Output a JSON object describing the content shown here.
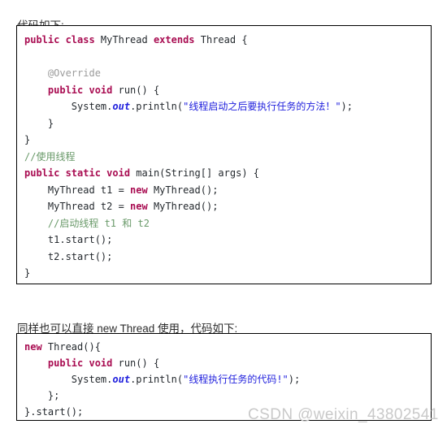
{
  "article": {
    "intro_1": "代码如下:",
    "intro_2": "同样也可以直接 new Thread 使用，代码如下:"
  },
  "code_block_1": {
    "language": "java",
    "lines": [
      [
        {
          "t": "public class ",
          "c": "kw"
        },
        {
          "t": "MyThread ",
          "c": "pln"
        },
        {
          "t": "extends ",
          "c": "kw"
        },
        {
          "t": "Thread {",
          "c": "pln"
        }
      ],
      [],
      [
        {
          "t": "    @Override",
          "c": "ann"
        }
      ],
      [
        {
          "t": "    ",
          "c": "pln"
        },
        {
          "t": "public void ",
          "c": "kw"
        },
        {
          "t": "run() {",
          "c": "pln"
        }
      ],
      [
        {
          "t": "        System.",
          "c": "pln"
        },
        {
          "t": "out",
          "c": "fld"
        },
        {
          "t": ".println(",
          "c": "pln"
        },
        {
          "t": "\"线程启动之后要执行任务的方法！\"",
          "c": "str"
        },
        {
          "t": ");",
          "c": "pln"
        }
      ],
      [
        {
          "t": "    }",
          "c": "pln"
        }
      ],
      [
        {
          "t": "}",
          "c": "pln"
        }
      ],
      [
        {
          "t": "//使用线程",
          "c": "cmt"
        }
      ],
      [
        {
          "t": "public static void ",
          "c": "kw"
        },
        {
          "t": "main(String[] args) {",
          "c": "pln"
        }
      ],
      [
        {
          "t": "    MyThread t1 = ",
          "c": "pln"
        },
        {
          "t": "new ",
          "c": "kw"
        },
        {
          "t": "MyThread();",
          "c": "pln"
        }
      ],
      [
        {
          "t": "    MyThread t2 = ",
          "c": "pln"
        },
        {
          "t": "new ",
          "c": "kw"
        },
        {
          "t": "MyThread();",
          "c": "pln"
        }
      ],
      [
        {
          "t": "    //启动线程 t1 和 t2",
          "c": "cmt"
        }
      ],
      [
        {
          "t": "    t1.start();",
          "c": "pln"
        }
      ],
      [
        {
          "t": "    t2.start();",
          "c": "pln"
        }
      ],
      [
        {
          "t": "}",
          "c": "pln"
        }
      ]
    ]
  },
  "code_block_2": {
    "language": "java",
    "lines": [
      [
        {
          "t": "new ",
          "c": "kw"
        },
        {
          "t": "Thread(){",
          "c": "pln"
        }
      ],
      [
        {
          "t": "    ",
          "c": "pln"
        },
        {
          "t": "public void ",
          "c": "kw"
        },
        {
          "t": "run() {",
          "c": "pln"
        }
      ],
      [
        {
          "t": "        System.",
          "c": "pln"
        },
        {
          "t": "out",
          "c": "fld"
        },
        {
          "t": ".println(",
          "c": "pln"
        },
        {
          "t": "\"线程执行任务的代码!\"",
          "c": "str"
        },
        {
          "t": ");",
          "c": "pln"
        }
      ],
      [
        {
          "t": "    };",
          "c": "pln"
        }
      ],
      [
        {
          "t": "}.start();",
          "c": "pln"
        }
      ]
    ]
  },
  "watermark": {
    "text": "CSDN @weixin_43802541"
  },
  "colors": {
    "keyword": "#a90d52",
    "string": "#2020dd",
    "comment": "#6a9a6a",
    "annotation": "#9b9b9b",
    "plain": "#24292e",
    "border": "#000000",
    "background": "#ffffff",
    "watermark": "#c9c9c9"
  }
}
